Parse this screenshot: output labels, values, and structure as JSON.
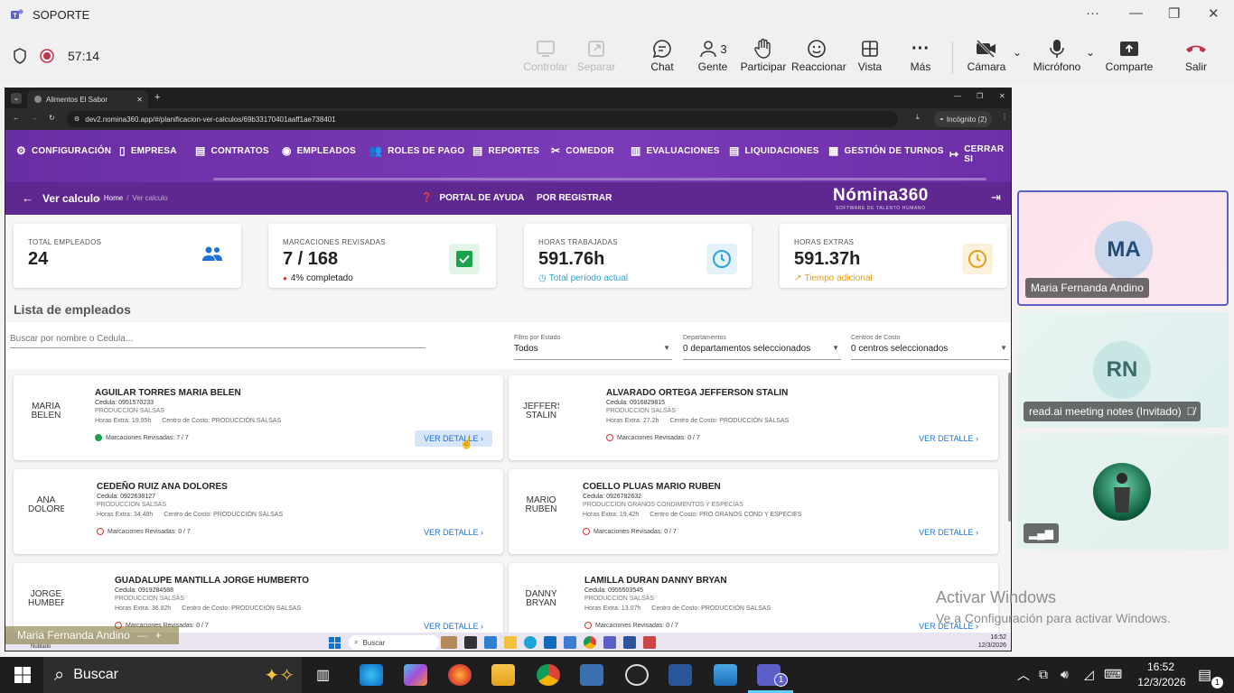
{
  "teams": {
    "title": "SOPORTE",
    "recording_time": "57:14",
    "toolbar": {
      "controlar": "Controlar",
      "separar": "Separar",
      "chat": "Chat",
      "gente": "Gente",
      "gente_count": "3",
      "participar": "Participar",
      "reaccionar": "Reaccionar",
      "vista": "Vista",
      "mas": "Más",
      "camara": "Cámara",
      "microfono": "Micrófono",
      "comparte": "Comparte",
      "salir": "Salir"
    },
    "participants": [
      {
        "initials": "MA",
        "name": "Maria Fernanda Andino"
      },
      {
        "initials": "RN",
        "name": "read.ai meeting notes (Invitado)"
      },
      {
        "initials": "",
        "name": ""
      }
    ],
    "self_view_name": "Maria Fernanda Andino",
    "self_view_sub": "Nublado"
  },
  "browser": {
    "tab_title": "Alimentos El Sabor",
    "url": "dev2.nomina360.app/#/planificacion-ver-calculos/69b33170401aaff1ae738401",
    "incognito": "Incógnito (2)",
    "time": "16:52",
    "date": "12/3/2026",
    "search": "Buscar"
  },
  "app": {
    "nav": [
      "CONFIGURACIÓN",
      "EMPRESA",
      "CONTRATOS",
      "EMPLEADOS",
      "ROLES DE PAGO",
      "REPORTES",
      "COMEDOR",
      "EVALUACIONES",
      "LIQUIDACIONES",
      "GESTIÓN DE TURNOS",
      "CERRAR SI"
    ],
    "page_title": "Ver calculo",
    "breadcrumb_home": "Home",
    "breadcrumb_current": "Ver calculo",
    "portal": "PORTAL DE AYUDA",
    "por_registrar": "POR REGISTRAR",
    "logo": "Nómina360",
    "logo_sub": "SOFTWARE DE TALENTO HUMANO",
    "stats": [
      {
        "label": "TOTAL EMPLEADOS",
        "value": "24",
        "sub": ""
      },
      {
        "label": "MARCACIONES REVISADAS",
        "value": "7 / 168",
        "sub": "4% completado"
      },
      {
        "label": "HORAS TRABAJADAS",
        "value": "591.76h",
        "sub": "Total período actual"
      },
      {
        "label": "HORAS EXTRAS",
        "value": "591.37h",
        "sub": "Tiempo adicional"
      }
    ],
    "list_title": "Lista de empleados",
    "search_placeholder": "Buscar por nombre o Cedula...",
    "filters": {
      "estado_label": "Filtro por Estado",
      "estado_value": "Todos",
      "dep_label": "Departamentos",
      "dep_value": "0 departamentos seleccionados",
      "cc_label": "Centros de Costo",
      "cc_value": "0 centros seleccionados"
    },
    "ver_detalle": "VER DETALLE",
    "employees": [
      {
        "photo": "MARIA BELEN",
        "name": "AGUILAR TORRES MARIA BELEN",
        "cedula": "Cedula: 0951570233",
        "dep": "PRODUCCION SALSAS",
        "hx": "Horas Extra: 19.95h",
        "cc": "Centro de Costo: PRODUCCIÓN SALSAS",
        "marc": "Marcaciones Revisadas: 7 / 7"
      },
      {
        "photo": "JEFFERSON STALIN",
        "name": "ALVARADO ORTEGA JEFFERSON STALIN",
        "cedula": "Cedula: 0916829815",
        "dep": "PRODUCCION SALSAS",
        "hx": "Horas Extra: 27.2h",
        "cc": "Centro de Costo: PRODUCCIÓN SALSAS",
        "marc": "Marcaciones Revisadas: 0 / 7"
      },
      {
        "photo": "ANA DOLORES",
        "name": "CEDEÑO RUIZ ANA DOLORES",
        "cedula": "Cedula: 0922638127",
        "dep": "PRODUCCION SALSAS",
        "hx": "Horas Extra: 34.48h",
        "cc": "Centro de Costo: PRODUCCIÓN SALSAS",
        "marc": "Marcaciones Revisadas: 0 / 7"
      },
      {
        "photo": "MARIO RUBEN",
        "name": "COELLO PLUAS MARIO RUBEN",
        "cedula": "Cedula: 0926782632",
        "dep": "PRODUCCION GRANOS CONDIMENTOS Y ESPECIAS",
        "hx": "Horas Extra: 19.42h",
        "cc": "Centro de Costo: PRO GRANOS COND Y ESPECIES",
        "marc": "Marcaciones Revisadas: 0 / 7"
      },
      {
        "photo": "JORGE HUMBERTO",
        "name": "GUADALUPE MANTILLA JORGE HUMBERTO",
        "cedula": "Cedula: 0919284588",
        "dep": "PRODUCCION SALSAS",
        "hx": "Horas Extra: 36.82h",
        "cc": "Centro de Costo: PRODUCCIÓN SALSAS",
        "marc": "Marcaciones Revisadas: 0 / 7"
      },
      {
        "photo": "DANNY BRYAN",
        "name": "LAMILLA DURAN DANNY BRYAN",
        "cedula": "Cedula: 0955503545",
        "dep": "PRODUCCION SALSAS",
        "hx": "Horas Extra: 13.07h",
        "cc": "Centro de Costo: PRODUCCIÓN SALSAS",
        "marc": "Marcaciones Revisadas: 0 / 7"
      }
    ]
  },
  "watermark": {
    "line1": "Activar Windows",
    "line2": "Ve a Configuración para activar Windows."
  },
  "taskbar": {
    "search": "Buscar",
    "time": "16:52",
    "date": "12/3/2026",
    "badge": "1"
  }
}
